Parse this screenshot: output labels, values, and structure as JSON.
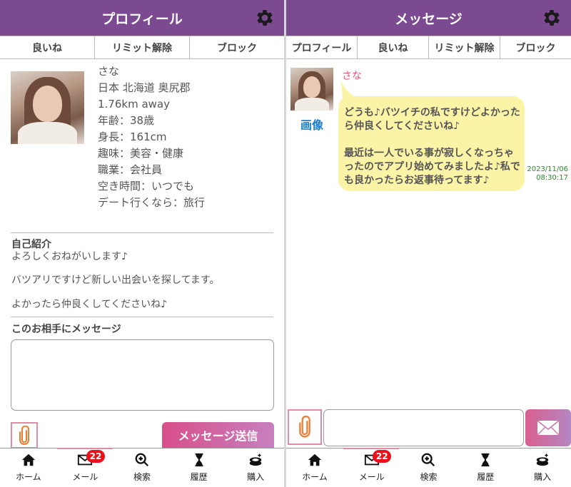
{
  "colors": {
    "header": "#7b4a91",
    "badge": "#e8121a",
    "bubble": "#fbf3a6",
    "sender": "#e0577f",
    "image_link": "#1a7fd0",
    "timestamp": "#2a8a2a"
  },
  "profile_screen": {
    "title": "プロフィール",
    "tabs": [
      "良いね",
      "リミット解除",
      "ブロック"
    ],
    "info": {
      "name": "さな",
      "location": "日本 北海道 奥尻郡",
      "distance": "1.76km away",
      "age": "年齢：38歳",
      "height": "身長：161cm",
      "hobby": "趣味：美容・健康",
      "job": "職業：会社員",
      "free_time": "空き時間：いつでも",
      "date": "デート行くなら：旅行"
    },
    "intro_label": "自己紹介",
    "intro_lines": [
      "よろしくおねがいします♪",
      "バツアリですけど新しい出会いを探してます。",
      "よかったら仲良くしてくださいね♪"
    ],
    "message_label": "このお相手にメッセージ",
    "send_button": "メッセージ送信"
  },
  "message_screen": {
    "title": "メッセージ",
    "tabs": [
      "プロフィール",
      "良いね",
      "リミット解除",
      "ブロック"
    ],
    "sender": "さな",
    "image_link": "画像",
    "message_paragraphs": [
      "どうも♪バツイチの私ですけどよかったら仲良くしてくださいね♪",
      "最近は一人でいる事が寂しくなっちゃったのでアプリ始めてみましたよ♪私でも良かったらお返事待ってます♪"
    ],
    "timestamp_date": "2023/11/06",
    "timestamp_time": "08:30:17"
  },
  "nav": {
    "items": [
      {
        "label": "ホーム",
        "icon": "home-icon"
      },
      {
        "label": "メール",
        "icon": "mail-icon"
      },
      {
        "label": "検索",
        "icon": "search-icon"
      },
      {
        "label": "履歴",
        "icon": "hourglass-icon"
      },
      {
        "label": "購入",
        "icon": "coin-purchase-icon"
      }
    ],
    "mail_badge": "22"
  }
}
